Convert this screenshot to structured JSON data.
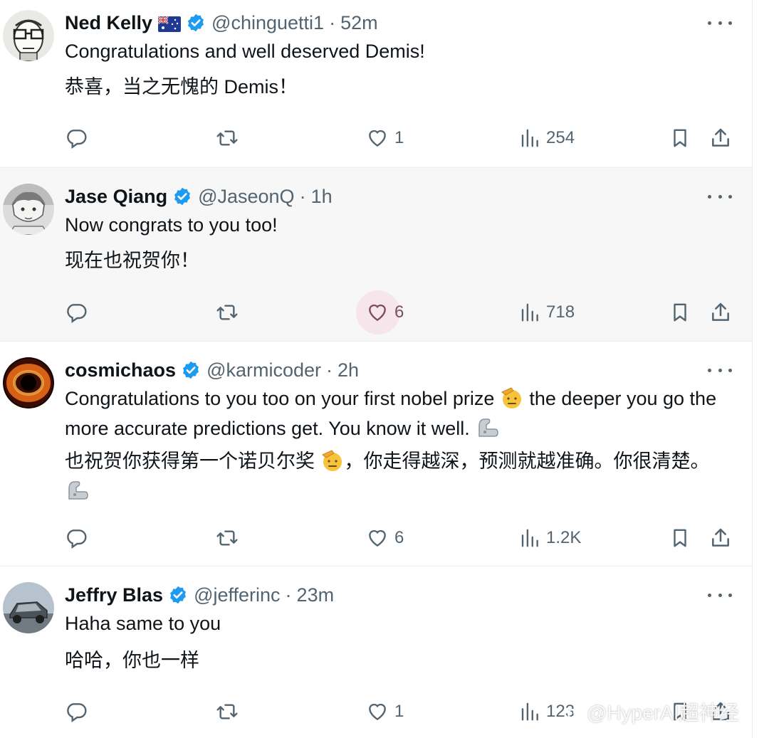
{
  "colors": {
    "text": "#0f1419",
    "muted": "#536471",
    "verified": "#1d9bf0",
    "border": "#e6ecf0",
    "highlight_bg": "#f7f7f7"
  },
  "tweets": [
    {
      "name": "Ned Kelly",
      "handle": "@chinguetti1",
      "time": "52m",
      "lines": [
        "Congratulations and well deserved Demis!",
        "恭喜，当之无愧的 Demis！"
      ],
      "replies": "",
      "reposts": "",
      "likes": "1",
      "views": "254",
      "has_flag": true,
      "flag_icon": "australia-flag-icon"
    },
    {
      "name": "Jase Qiang",
      "handle": "@JaseonQ",
      "time": "1h",
      "lines": [
        "Now congrats to you too!",
        "现在也祝贺你！"
      ],
      "replies": "",
      "reposts": "",
      "likes": "6",
      "views": "718"
    },
    {
      "name": "cosmichaos",
      "handle": "@karmicoder",
      "time": "2h",
      "en_part1": "Congratulations to you too on your first nobel prize",
      "en_part2": " the deeper you go the more accurate predictions get. You know it well.",
      "zh_part1": "也祝贺你获得第一个诺贝尔奖",
      "zh_part2": "，你走得越深，预测就越准确。你很清楚。",
      "replies": "",
      "reposts": "",
      "likes": "6",
      "views": "1.2K"
    },
    {
      "name": "Jeffry Blas",
      "handle": "@jefferinc",
      "time": "23m",
      "lines": [
        "Haha same to you",
        "哈哈，你也一样"
      ],
      "replies": "",
      "reposts": "",
      "likes": "1",
      "views": "123"
    }
  ],
  "watermark": "@HyperAI超神经",
  "separator": "·"
}
